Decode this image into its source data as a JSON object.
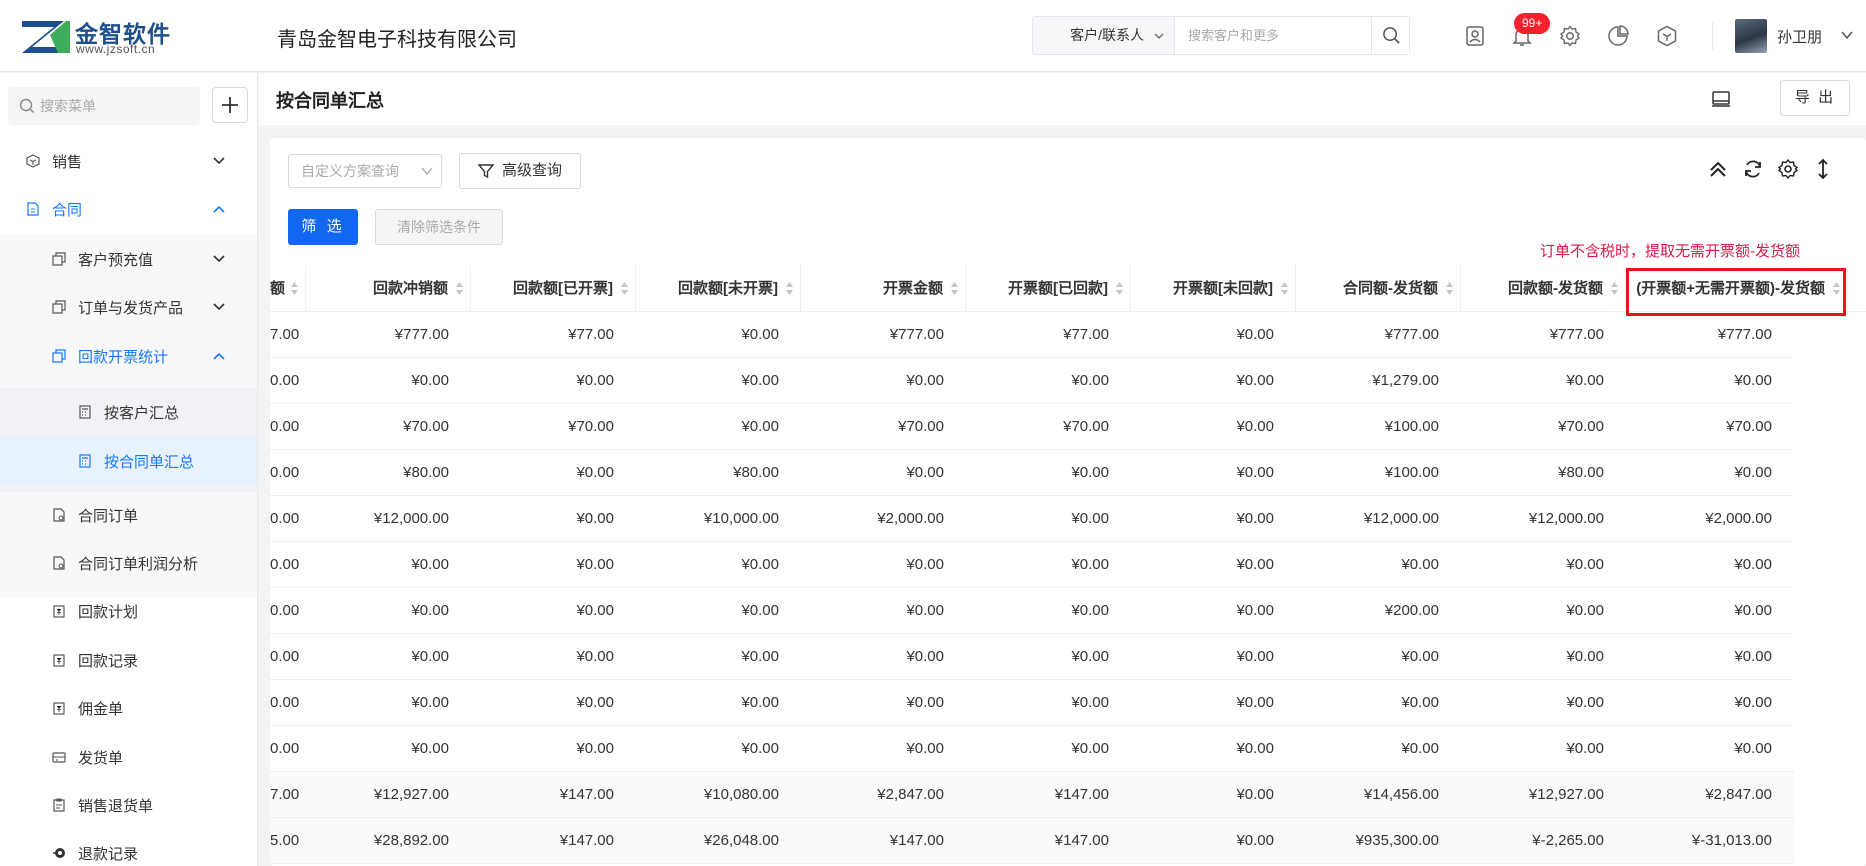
{
  "header": {
    "logo_name": "金智软件",
    "logo_url": "www.jzsoft.cn",
    "company": "青岛金智电子科技有限公司",
    "search_type": "客户/联系人",
    "search_placeholder": "搜索客户和更多",
    "notification_count": "99+",
    "username": "孙卫朋",
    "icons": [
      "contacts-icon",
      "bell-icon",
      "gear-icon",
      "pie-chart-icon",
      "cube-icon"
    ]
  },
  "sidebar": {
    "search_placeholder": "搜索菜单",
    "items": [
      {
        "label": "销售"
      },
      {
        "label": "合同"
      },
      {
        "label": "客户预充值"
      },
      {
        "label": "订单与发货产品"
      },
      {
        "label": "回款开票统计"
      },
      {
        "label": "按客户汇总"
      },
      {
        "label": "按合同单汇总"
      },
      {
        "label": "合同订单"
      },
      {
        "label": "合同订单利润分析"
      },
      {
        "label": "回款计划"
      },
      {
        "label": "回款记录"
      },
      {
        "label": "佣金单"
      },
      {
        "label": "发货单"
      },
      {
        "label": "销售退货单"
      },
      {
        "label": "退款记录"
      }
    ]
  },
  "main": {
    "title": "按合同单汇总",
    "export_label": "导 出",
    "scheme_placeholder": "自定义方案查询",
    "advanced_label": "高级查询",
    "filter_label": "筛 选",
    "clear_label": "清除筛选条件",
    "annotation": "订单不含税时，提取无需开票额-发货额"
  },
  "table": {
    "columns": [
      "额",
      "回款冲销额",
      "回款额[已开票]",
      "回款额[未开票]",
      "开票金额",
      "开票额[已回款]",
      "开票额[未回款]",
      "合同额-发货额",
      "回款额-发货额",
      "(开票额+无需开票额)-发货额"
    ],
    "rows": [
      [
        "7.00",
        "¥777.00",
        "¥77.00",
        "¥0.00",
        "¥777.00",
        "¥77.00",
        "¥0.00",
        "¥777.00",
        "¥777.00",
        "¥777.00"
      ],
      [
        "0.00",
        "¥0.00",
        "¥0.00",
        "¥0.00",
        "¥0.00",
        "¥0.00",
        "¥0.00",
        "¥1,279.00",
        "¥0.00",
        "¥0.00"
      ],
      [
        "0.00",
        "¥70.00",
        "¥70.00",
        "¥0.00",
        "¥70.00",
        "¥70.00",
        "¥0.00",
        "¥100.00",
        "¥70.00",
        "¥70.00"
      ],
      [
        "0.00",
        "¥80.00",
        "¥0.00",
        "¥80.00",
        "¥0.00",
        "¥0.00",
        "¥0.00",
        "¥100.00",
        "¥80.00",
        "¥0.00"
      ],
      [
        "0.00",
        "¥12,000.00",
        "¥0.00",
        "¥10,000.00",
        "¥2,000.00",
        "¥0.00",
        "¥0.00",
        "¥12,000.00",
        "¥12,000.00",
        "¥2,000.00"
      ],
      [
        "0.00",
        "¥0.00",
        "¥0.00",
        "¥0.00",
        "¥0.00",
        "¥0.00",
        "¥0.00",
        "¥0.00",
        "¥0.00",
        "¥0.00"
      ],
      [
        "0.00",
        "¥0.00",
        "¥0.00",
        "¥0.00",
        "¥0.00",
        "¥0.00",
        "¥0.00",
        "¥200.00",
        "¥0.00",
        "¥0.00"
      ],
      [
        "0.00",
        "¥0.00",
        "¥0.00",
        "¥0.00",
        "¥0.00",
        "¥0.00",
        "¥0.00",
        "¥0.00",
        "¥0.00",
        "¥0.00"
      ],
      [
        "0.00",
        "¥0.00",
        "¥0.00",
        "¥0.00",
        "¥0.00",
        "¥0.00",
        "¥0.00",
        "¥0.00",
        "¥0.00",
        "¥0.00"
      ],
      [
        "0.00",
        "¥0.00",
        "¥0.00",
        "¥0.00",
        "¥0.00",
        "¥0.00",
        "¥0.00",
        "¥0.00",
        "¥0.00",
        "¥0.00"
      ]
    ],
    "summary": [
      [
        "7.00",
        "¥12,927.00",
        "¥147.00",
        "¥10,080.00",
        "¥2,847.00",
        "¥147.00",
        "¥0.00",
        "¥14,456.00",
        "¥12,927.00",
        "¥2,847.00"
      ],
      [
        "5.00",
        "¥28,892.00",
        "¥147.00",
        "¥26,048.00",
        "¥147.00",
        "¥147.00",
        "¥0.00",
        "¥935,300.00",
        "¥-2,265.00",
        "¥-31,013.00"
      ]
    ]
  }
}
